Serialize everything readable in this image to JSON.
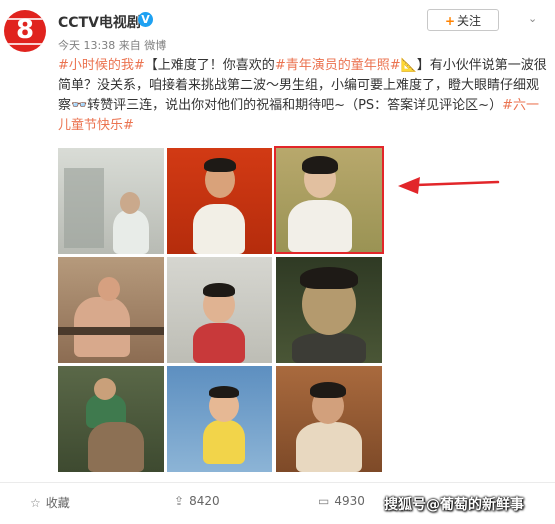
{
  "post": {
    "author": "CCTV电视剧",
    "verified_mark": "V",
    "avatar_number": "8",
    "time": "今天 13:38",
    "source_prefix": "来自",
    "source": "微博",
    "follow_label": "关注",
    "follow_plus": "+",
    "more_label": "⌄",
    "text_parts": [
      {
        "text": "#小时候的我#",
        "link": true
      },
      {
        "text": "【上难度了！你喜欢的",
        "link": false
      },
      {
        "text": "#青年演员的童年照#",
        "link": true
      },
      {
        "text": "📐】有小伙伴说第一波很简单？没关系，咱接着来挑战第二波～男生组，小编可要上难度了，瞪大眼睛仔细观察👓转赞评三连，说出你对他们的祝福和期待吧~（PS：答案详见评论区~）",
        "link": false
      },
      {
        "text": "#六一儿童节快乐#",
        "link": true
      }
    ]
  },
  "footer": {
    "favorite_label": "收藏",
    "repost_count": "8420",
    "comment_count": "4930"
  },
  "watermark": "搜狐号@葡萄的新鲜事",
  "colors": {
    "link": "#eb7350",
    "highlight_border": "#e2262a",
    "arrow": "#e2262a",
    "follow_plus": "#ff8200"
  }
}
